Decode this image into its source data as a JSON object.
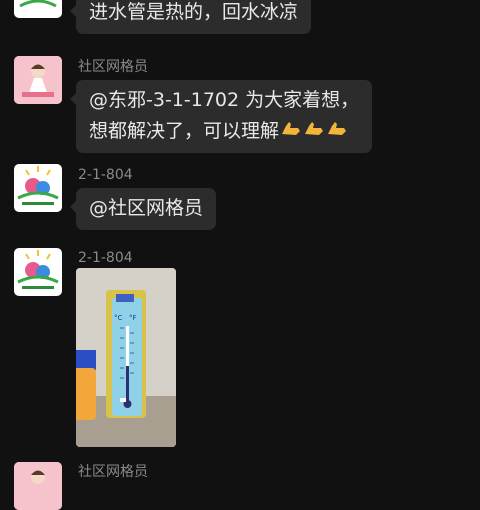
{
  "messages": [
    {
      "type": "text",
      "sender": "",
      "lines": [
        "进水管是热的，回水冰凉"
      ],
      "emoji": ""
    },
    {
      "type": "text",
      "sender": "社区网格员",
      "lines": [
        "@东邪-3-1-1702 为大家着想，",
        "想都解决了，可以理解"
      ],
      "emoji": "thumbs-up-icon x3"
    },
    {
      "type": "text",
      "sender": "2-1-804",
      "lines": [
        "@社区网格员"
      ],
      "emoji": ""
    },
    {
      "type": "image",
      "sender": "2-1-804",
      "image": "thermometer-photo"
    },
    {
      "type": "text",
      "sender": "社区网格员",
      "lines": [],
      "emoji": ""
    }
  ],
  "thermometer": {
    "scale_left": "°C",
    "scale_right": "°F"
  },
  "colors": {
    "background": "#111111",
    "bubble": "#2c2c2c",
    "sender_text": "#8a8a8a",
    "message_text": "#e8e8e8"
  }
}
